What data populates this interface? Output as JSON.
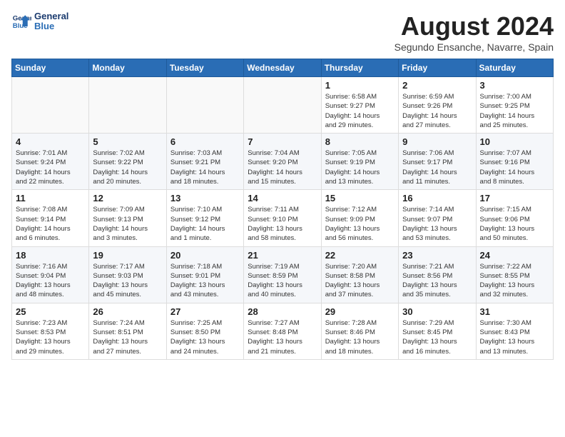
{
  "logo": {
    "line1": "General",
    "line2": "Blue"
  },
  "header": {
    "month_year": "August 2024",
    "location": "Segundo Ensanche, Navarre, Spain"
  },
  "weekdays": [
    "Sunday",
    "Monday",
    "Tuesday",
    "Wednesday",
    "Thursday",
    "Friday",
    "Saturday"
  ],
  "weeks": [
    [
      {
        "day": "",
        "info": ""
      },
      {
        "day": "",
        "info": ""
      },
      {
        "day": "",
        "info": ""
      },
      {
        "day": "",
        "info": ""
      },
      {
        "day": "1",
        "info": "Sunrise: 6:58 AM\nSunset: 9:27 PM\nDaylight: 14 hours\nand 29 minutes."
      },
      {
        "day": "2",
        "info": "Sunrise: 6:59 AM\nSunset: 9:26 PM\nDaylight: 14 hours\nand 27 minutes."
      },
      {
        "day": "3",
        "info": "Sunrise: 7:00 AM\nSunset: 9:25 PM\nDaylight: 14 hours\nand 25 minutes."
      }
    ],
    [
      {
        "day": "4",
        "info": "Sunrise: 7:01 AM\nSunset: 9:24 PM\nDaylight: 14 hours\nand 22 minutes."
      },
      {
        "day": "5",
        "info": "Sunrise: 7:02 AM\nSunset: 9:22 PM\nDaylight: 14 hours\nand 20 minutes."
      },
      {
        "day": "6",
        "info": "Sunrise: 7:03 AM\nSunset: 9:21 PM\nDaylight: 14 hours\nand 18 minutes."
      },
      {
        "day": "7",
        "info": "Sunrise: 7:04 AM\nSunset: 9:20 PM\nDaylight: 14 hours\nand 15 minutes."
      },
      {
        "day": "8",
        "info": "Sunrise: 7:05 AM\nSunset: 9:19 PM\nDaylight: 14 hours\nand 13 minutes."
      },
      {
        "day": "9",
        "info": "Sunrise: 7:06 AM\nSunset: 9:17 PM\nDaylight: 14 hours\nand 11 minutes."
      },
      {
        "day": "10",
        "info": "Sunrise: 7:07 AM\nSunset: 9:16 PM\nDaylight: 14 hours\nand 8 minutes."
      }
    ],
    [
      {
        "day": "11",
        "info": "Sunrise: 7:08 AM\nSunset: 9:14 PM\nDaylight: 14 hours\nand 6 minutes."
      },
      {
        "day": "12",
        "info": "Sunrise: 7:09 AM\nSunset: 9:13 PM\nDaylight: 14 hours\nand 3 minutes."
      },
      {
        "day": "13",
        "info": "Sunrise: 7:10 AM\nSunset: 9:12 PM\nDaylight: 14 hours\nand 1 minute."
      },
      {
        "day": "14",
        "info": "Sunrise: 7:11 AM\nSunset: 9:10 PM\nDaylight: 13 hours\nand 58 minutes."
      },
      {
        "day": "15",
        "info": "Sunrise: 7:12 AM\nSunset: 9:09 PM\nDaylight: 13 hours\nand 56 minutes."
      },
      {
        "day": "16",
        "info": "Sunrise: 7:14 AM\nSunset: 9:07 PM\nDaylight: 13 hours\nand 53 minutes."
      },
      {
        "day": "17",
        "info": "Sunrise: 7:15 AM\nSunset: 9:06 PM\nDaylight: 13 hours\nand 50 minutes."
      }
    ],
    [
      {
        "day": "18",
        "info": "Sunrise: 7:16 AM\nSunset: 9:04 PM\nDaylight: 13 hours\nand 48 minutes."
      },
      {
        "day": "19",
        "info": "Sunrise: 7:17 AM\nSunset: 9:03 PM\nDaylight: 13 hours\nand 45 minutes."
      },
      {
        "day": "20",
        "info": "Sunrise: 7:18 AM\nSunset: 9:01 PM\nDaylight: 13 hours\nand 43 minutes."
      },
      {
        "day": "21",
        "info": "Sunrise: 7:19 AM\nSunset: 8:59 PM\nDaylight: 13 hours\nand 40 minutes."
      },
      {
        "day": "22",
        "info": "Sunrise: 7:20 AM\nSunset: 8:58 PM\nDaylight: 13 hours\nand 37 minutes."
      },
      {
        "day": "23",
        "info": "Sunrise: 7:21 AM\nSunset: 8:56 PM\nDaylight: 13 hours\nand 35 minutes."
      },
      {
        "day": "24",
        "info": "Sunrise: 7:22 AM\nSunset: 8:55 PM\nDaylight: 13 hours\nand 32 minutes."
      }
    ],
    [
      {
        "day": "25",
        "info": "Sunrise: 7:23 AM\nSunset: 8:53 PM\nDaylight: 13 hours\nand 29 minutes."
      },
      {
        "day": "26",
        "info": "Sunrise: 7:24 AM\nSunset: 8:51 PM\nDaylight: 13 hours\nand 27 minutes."
      },
      {
        "day": "27",
        "info": "Sunrise: 7:25 AM\nSunset: 8:50 PM\nDaylight: 13 hours\nand 24 minutes."
      },
      {
        "day": "28",
        "info": "Sunrise: 7:27 AM\nSunset: 8:48 PM\nDaylight: 13 hours\nand 21 minutes."
      },
      {
        "day": "29",
        "info": "Sunrise: 7:28 AM\nSunset: 8:46 PM\nDaylight: 13 hours\nand 18 minutes."
      },
      {
        "day": "30",
        "info": "Sunrise: 7:29 AM\nSunset: 8:45 PM\nDaylight: 13 hours\nand 16 minutes."
      },
      {
        "day": "31",
        "info": "Sunrise: 7:30 AM\nSunset: 8:43 PM\nDaylight: 13 hours\nand 13 minutes."
      }
    ]
  ]
}
